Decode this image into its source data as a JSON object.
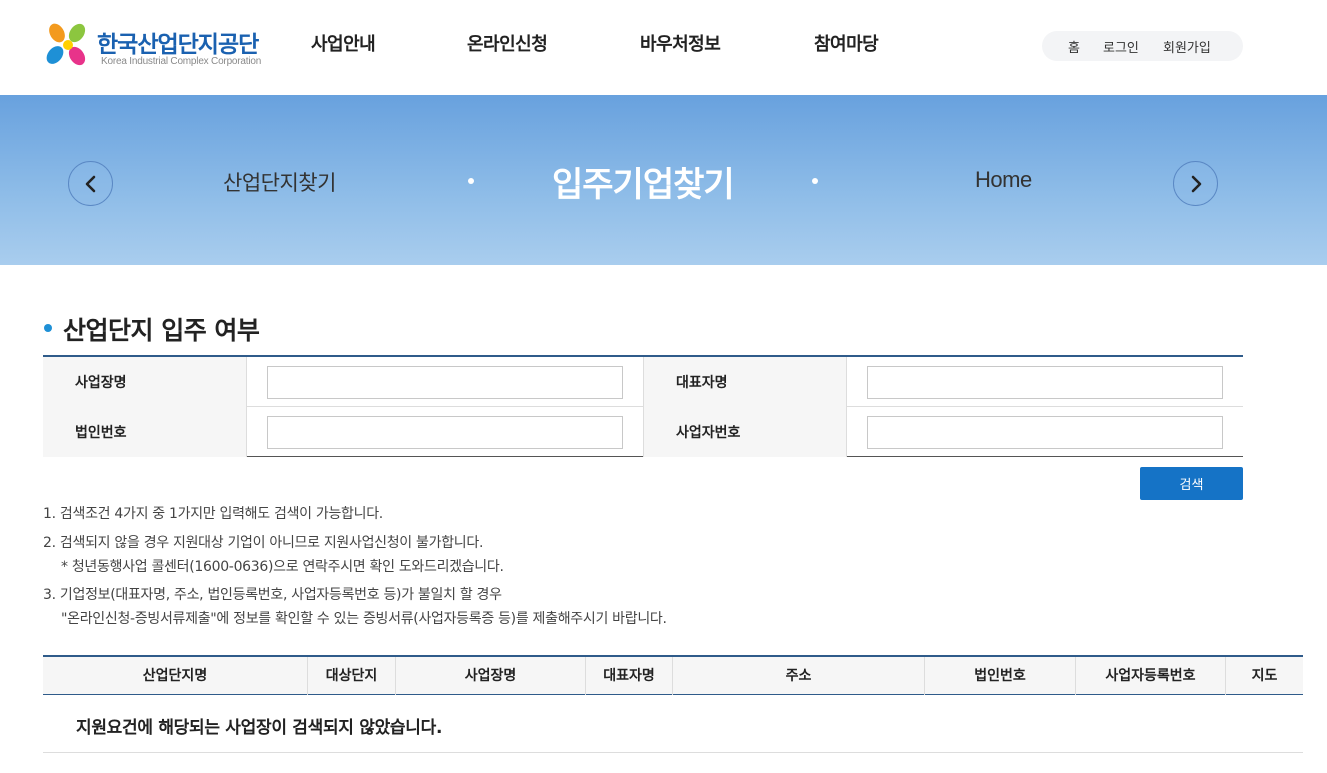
{
  "brand": {
    "name": "한국산업단지공단",
    "name_en": "Korea Industrial Complex Corporation"
  },
  "gnb": [
    "사업안내",
    "온라인신청",
    "바우처정보",
    "참여마당"
  ],
  "util": [
    "홈",
    "로그인",
    "회원가입"
  ],
  "banner": {
    "prev": "산업단지찾기",
    "current": "입주기업찾기",
    "next": "Home"
  },
  "section": {
    "title": "산업단지 입주 여부"
  },
  "form": {
    "business_name_label": "사업장명",
    "ceo_name_label": "대표자명",
    "corp_no_label": "법인번호",
    "biz_reg_no_label": "사업자번호",
    "business_name_value": "",
    "ceo_name_value": "",
    "corp_no_value": "",
    "biz_reg_no_value": "",
    "search_label": "검색"
  },
  "notes": [
    "1. 검색조건 4가지 중 1가지만 입력해도 검색이 가능합니다.",
    "2. 검색되지 않을 경우 지원대상 기업이 아니므로 지원사업신청이 불가합니다.",
    "* 청년동행사업 콜센터(1600-0636)으로 연락주시면 확인 도와드리겠습니다.",
    "3. 기업정보(대표자명, 주소, 법인등록번호, 사업자등록번호 등)가 불일치 할 경우",
    "\"온라인신청-증빙서류제출\"에 정보를 확인할 수 있는 증빙서류(사업자등록증 등)를 제출해주시기 바랍니다."
  ],
  "table": {
    "columns": [
      "산업단지명",
      "대상단지",
      "사업장명",
      "대표자명",
      "주소",
      "법인번호",
      "사업자등록번호",
      "지도"
    ],
    "empty_message": "지원요건에 해당되는 사업장이 검색되지 않았습니다."
  },
  "colors": {
    "primary": "#1573c6",
    "brand_blue": "#1a61b0",
    "table_border": "#2f5b8a",
    "bullet": "#1e90d6"
  }
}
